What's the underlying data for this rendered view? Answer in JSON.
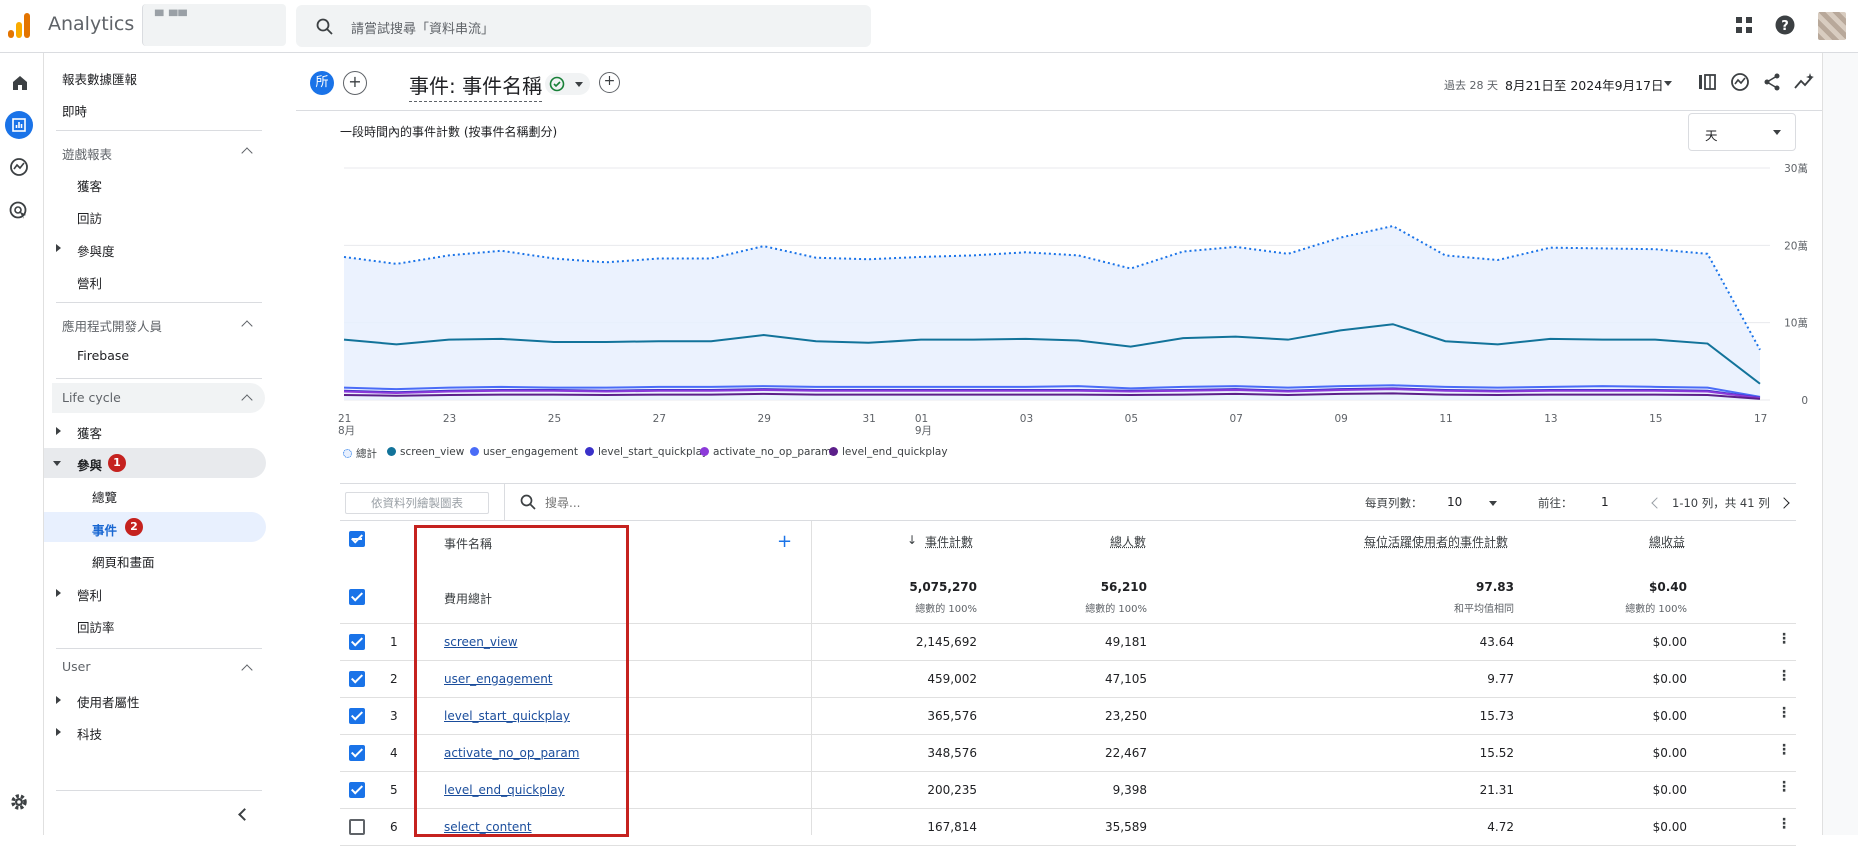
{
  "app": {
    "name": "Analytics",
    "account_placeholder": "▀ ▀▀"
  },
  "search": {
    "placeholder": "請嘗試搜尋「資料串流」"
  },
  "header": {
    "audience_chip": "所",
    "report_title": "事件: 事件名稱",
    "date_range_label": "過去 28 天",
    "date_range": "8月21日至 2024年9月17日"
  },
  "sidebar": {
    "top_items": [
      "報表數據匯報",
      "即時"
    ],
    "sections": [
      {
        "title": "遊戲報表",
        "items": [
          "獲客",
          "回訪",
          "參與度",
          "營利"
        ]
      },
      {
        "title": "應用程式開發人員",
        "items": [
          "Firebase"
        ]
      },
      {
        "title": "Life cycle",
        "items": [
          "獲客",
          "參與",
          "總覽",
          "事件",
          "網頁和畫面",
          "營利",
          "回訪率"
        ]
      },
      {
        "title": "User",
        "items": [
          "使用者屬性",
          "科技"
        ]
      }
    ],
    "badges": [
      "1",
      "2"
    ]
  },
  "chart": {
    "title": "一段時間內的事件計數 (按事件名稱劃分)",
    "granularity": "天"
  },
  "chart_data": {
    "type": "line",
    "title": "一段時間內的事件計數 (按事件名稱劃分)",
    "x": [
      "21",
      "22",
      "23",
      "24",
      "25",
      "26",
      "27",
      "28",
      "29",
      "30",
      "31",
      "01",
      "02",
      "03",
      "04",
      "05",
      "06",
      "07",
      "08",
      "09",
      "10",
      "11",
      "12",
      "13",
      "14",
      "15",
      "16",
      "17"
    ],
    "x_tick_labels": [
      "21",
      "23",
      "25",
      "27",
      "29",
      "31",
      "01",
      "03",
      "05",
      "07",
      "09",
      "11",
      "13",
      "15",
      "17"
    ],
    "x_month_labels": [
      {
        "at": "21",
        "label": "8月"
      },
      {
        "at": "01",
        "label": "9月"
      }
    ],
    "y_tick_labels": [
      "0",
      "10萬",
      "20萬",
      "30萬"
    ],
    "ylim": [
      0,
      300000
    ],
    "grid": true,
    "legend_position": "bottom-left",
    "series": [
      {
        "name": "總計",
        "color": "#1a73e8",
        "style": "dotted-area",
        "values": [
          185000,
          176000,
          187000,
          193000,
          183000,
          178000,
          183000,
          183000,
          199000,
          184000,
          182000,
          185000,
          187000,
          191000,
          187000,
          170000,
          192000,
          198000,
          189000,
          210000,
          225000,
          187000,
          181000,
          197000,
          196000,
          195000,
          189000,
          65000
        ]
      },
      {
        "name": "screen_view",
        "color": "#12739a",
        "values": [
          78000,
          72000,
          78000,
          79000,
          75000,
          75000,
          76000,
          76000,
          84000,
          76000,
          74000,
          78000,
          78000,
          79000,
          77000,
          69000,
          80000,
          82000,
          78000,
          90000,
          98000,
          76000,
          72000,
          79000,
          78000,
          78000,
          73000,
          21000
        ]
      },
      {
        "name": "user_engagement",
        "color": "#4a6cf7",
        "values": [
          16000,
          14000,
          16000,
          17000,
          16000,
          16000,
          17000,
          17000,
          18000,
          17000,
          17000,
          17000,
          17000,
          17000,
          18000,
          15000,
          17000,
          18000,
          16000,
          18000,
          19000,
          17000,
          16000,
          17000,
          18000,
          17000,
          16000,
          4000
        ]
      },
      {
        "name": "level_start_quickplay",
        "color": "#3a31c9",
        "values": [
          12000,
          10000,
          12000,
          13000,
          13000,
          12000,
          13000,
          13000,
          14000,
          13000,
          13000,
          13000,
          13000,
          13000,
          13000,
          12000,
          13000,
          14000,
          12000,
          14000,
          15000,
          13000,
          12000,
          13000,
          13000,
          13000,
          12000,
          3000
        ]
      },
      {
        "name": "activate_no_op_param",
        "color": "#8c3ad9",
        "values": [
          11000,
          9000,
          11000,
          12000,
          12000,
          11000,
          12000,
          12000,
          13000,
          12000,
          12000,
          12000,
          12000,
          12000,
          12000,
          11000,
          12000,
          13000,
          11000,
          13000,
          14000,
          12000,
          11000,
          12000,
          12000,
          12000,
          11000,
          2500
        ]
      },
      {
        "name": "level_end_quickplay",
        "color": "#5c1f8a",
        "values": [
          6500,
          5500,
          6500,
          7000,
          7000,
          6500,
          7000,
          7000,
          8000,
          7000,
          7000,
          7000,
          7000,
          7000,
          7000,
          6500,
          7000,
          8000,
          6500,
          8000,
          8500,
          7000,
          6500,
          7000,
          7000,
          7000,
          6500,
          1500
        ]
      }
    ]
  },
  "table_toolbar": {
    "plot_button": "依資料列繪製圖表",
    "search_placeholder": "搜尋...",
    "rows_per_page_label": "每頁列數：",
    "rows_per_page": "10",
    "goto_label": "前往：",
    "goto_value": "1",
    "range": "1-10 列，共 41 列"
  },
  "table": {
    "dim_header": "事件名稱",
    "headers": [
      "事件計數",
      "總人數",
      "每位活躍使用者的事件計數",
      "總收益"
    ],
    "totals_label": "費用總計",
    "totals": [
      "5,075,270",
      "56,210",
      "97.83",
      "$0.40"
    ],
    "totals_sub": [
      "總數的 100%",
      "總數的 100%",
      "和平均值相同",
      "總數的 100%"
    ],
    "rows": [
      {
        "idx": "1",
        "name": "screen_view",
        "count": "2,145,692",
        "users": "49,181",
        "per_user": "43.64",
        "revenue": "$0.00"
      },
      {
        "idx": "2",
        "name": "user_engagement",
        "count": "459,002",
        "users": "47,105",
        "per_user": "9.77",
        "revenue": "$0.00"
      },
      {
        "idx": "3",
        "name": "level_start_quickplay",
        "count": "365,576",
        "users": "23,250",
        "per_user": "15.73",
        "revenue": "$0.00"
      },
      {
        "idx": "4",
        "name": "activate_no_op_param",
        "count": "348,576",
        "users": "22,467",
        "per_user": "15.52",
        "revenue": "$0.00"
      },
      {
        "idx": "5",
        "name": "level_end_quickplay",
        "count": "200,235",
        "users": "9,398",
        "per_user": "21.31",
        "revenue": "$0.00"
      },
      {
        "idx": "6",
        "name": "select_content",
        "count": "167,814",
        "users": "35,589",
        "per_user": "4.72",
        "revenue": "$0.00"
      }
    ]
  },
  "colors": {
    "accent": "#1a73e8",
    "highlight": "#c5221f",
    "nav_active_bg": "#e8f0fe"
  }
}
